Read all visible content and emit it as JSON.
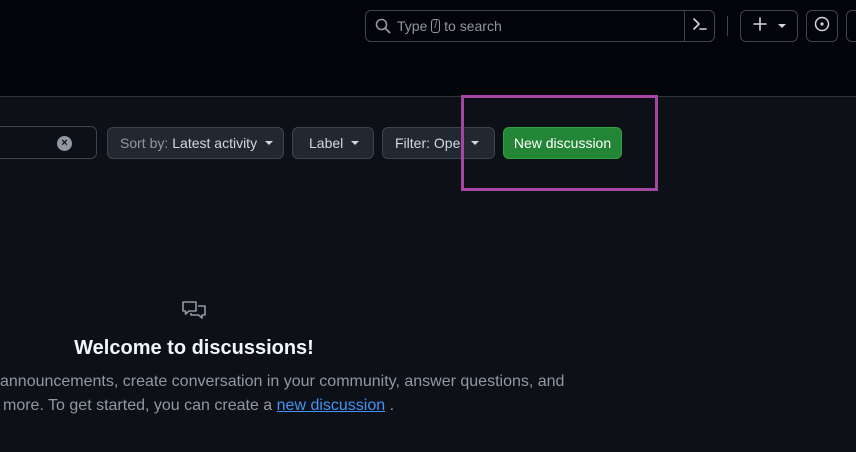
{
  "header": {
    "search": {
      "prefix": "Type",
      "key": "/",
      "suffix": "to search"
    }
  },
  "toolbar": {
    "sort_prefix": "Sort by:",
    "sort_value": "Latest activity",
    "label_button": "Label",
    "filter_button": "Filter: Open",
    "new_discussion_button": "New discussion"
  },
  "blankslate": {
    "title": "Welcome to discussions!",
    "line1": "announcements, create conversation in your community, answer questions, and",
    "line2_prefix": "more. To get started, you can create a",
    "link": "new discussion",
    "line2_suffix": "."
  },
  "colors": {
    "background": "#0d1117",
    "header_background": "#010409",
    "primary_button": "#238636",
    "link": "#4493f8",
    "highlight_box": "#a347a3"
  },
  "icons": [
    "search-icon",
    "command-palette-icon",
    "plus-icon",
    "chevron-down-icon",
    "issue-opened-icon",
    "clear-icon",
    "comment-discussion-icon"
  ]
}
